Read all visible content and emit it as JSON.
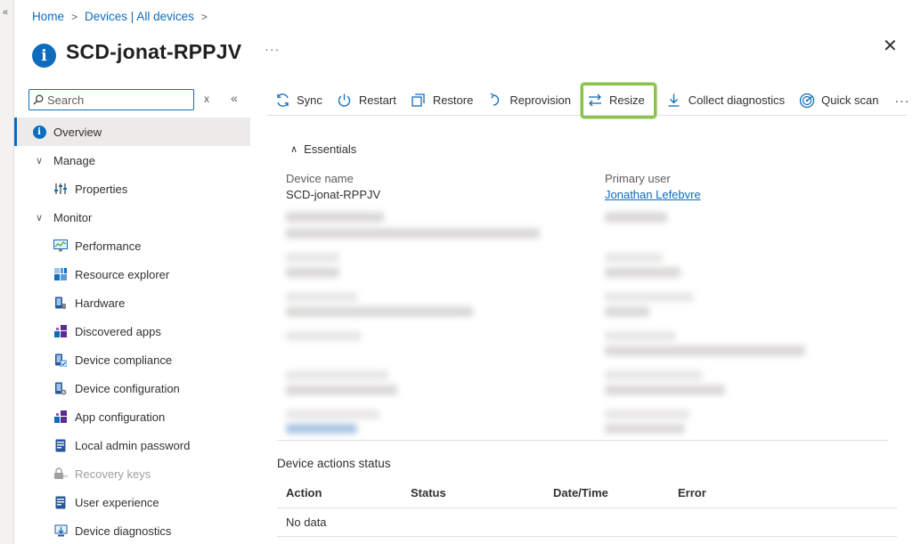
{
  "breadcrumb": {
    "home": "Home",
    "devices": "Devices | All devices",
    "sep": ">"
  },
  "header": {
    "title": "SCD-jonat-RPPJV",
    "more": "···",
    "close": "✕",
    "collapse": "«"
  },
  "search": {
    "placeholder": "Search",
    "clear": "x",
    "collapse": "«"
  },
  "sidebar": {
    "items": [
      {
        "label": "Overview"
      },
      {
        "label": "Manage"
      },
      {
        "label": "Properties"
      },
      {
        "label": "Monitor"
      },
      {
        "label": "Performance"
      },
      {
        "label": "Resource explorer"
      },
      {
        "label": "Hardware"
      },
      {
        "label": "Discovered apps"
      },
      {
        "label": "Device compliance"
      },
      {
        "label": "Device configuration"
      },
      {
        "label": "App configuration"
      },
      {
        "label": "Local admin password"
      },
      {
        "label": "Recovery keys"
      },
      {
        "label": "User experience"
      },
      {
        "label": "Device diagnostics"
      }
    ]
  },
  "toolbar": {
    "sync": "Sync",
    "restart": "Restart",
    "restore": "Restore",
    "reprovision": "Reprovision",
    "resize": "Resize",
    "collect": "Collect diagnostics",
    "quickscan": "Quick scan",
    "more": "···"
  },
  "essentials": {
    "toggle": "Essentials",
    "device_name_label": "Device name",
    "device_name_value": "SCD-jonat-RPPJV",
    "primary_user_label": "Primary user",
    "primary_user_value": "Jonathan Lefebvre"
  },
  "actions_status": {
    "title": "Device actions status",
    "columns": [
      "Action",
      "Status",
      "Date/Time",
      "Error"
    ],
    "empty": "No data"
  },
  "colors": {
    "accent": "#0f6cbd",
    "highlight": "#8bc34a",
    "selected_bg": "#edebe9"
  }
}
